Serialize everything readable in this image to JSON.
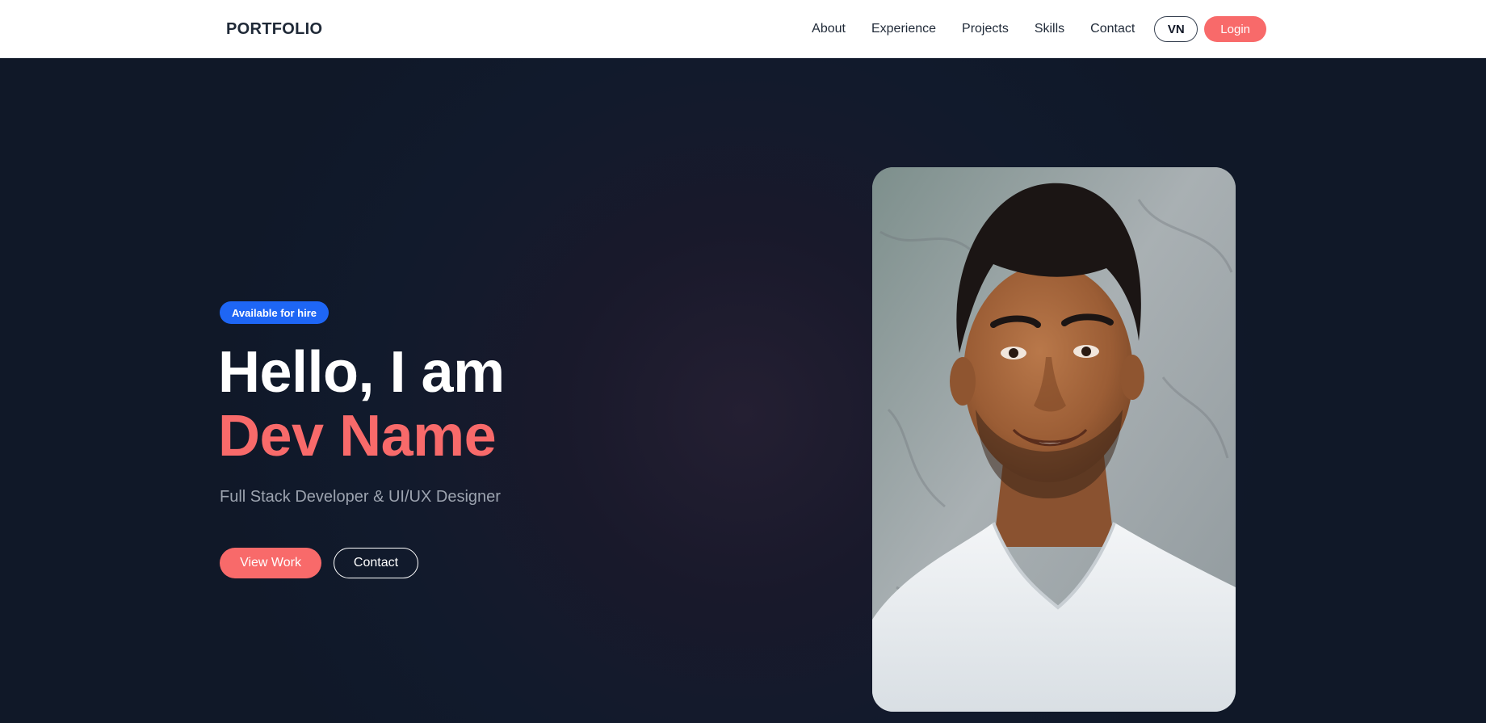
{
  "header": {
    "brand": "PORTFOLIO",
    "nav": [
      "About",
      "Experience",
      "Projects",
      "Skills",
      "Contact"
    ],
    "lang_label": "VN",
    "login_label": "Login"
  },
  "hero": {
    "badge": "Available for hire",
    "title_line1": "Hello, I am",
    "title_line2": "Dev Name",
    "subtitle": "Full Stack Developer & UI/UX Designer",
    "primary_button": "View Work",
    "secondary_button": "Contact"
  },
  "colors": {
    "accent": "#f86a6a",
    "badge": "#1e66f5",
    "background": "#101828"
  }
}
